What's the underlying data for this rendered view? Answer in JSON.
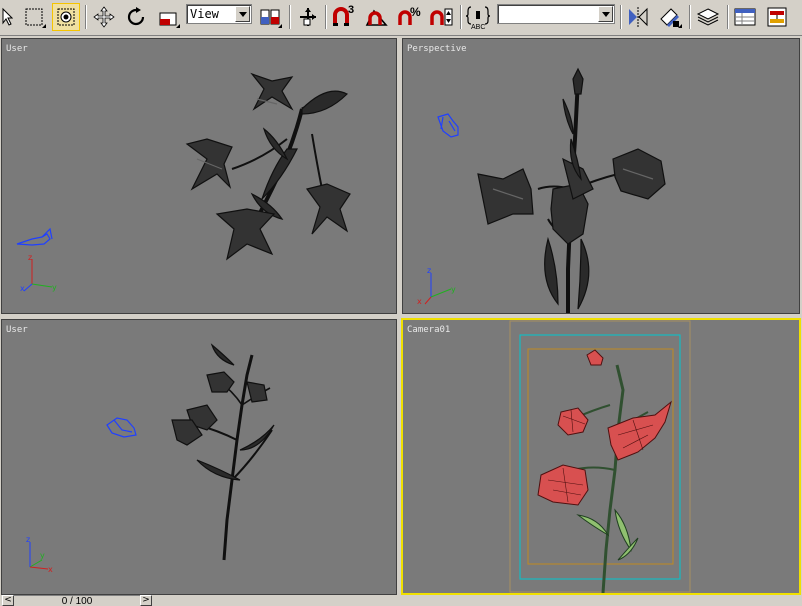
{
  "toolbar": {
    "view_dropdown": "View",
    "selection_set_dropdown": "",
    "spinner_snap_badge": "%",
    "angle_snap_badge": "3"
  },
  "viewports": [
    {
      "label": "User",
      "active": false
    },
    {
      "label": "Perspective",
      "active": false
    },
    {
      "label": "User",
      "active": false
    },
    {
      "label": "Camera01",
      "active": true
    }
  ],
  "axis_labels": {
    "x": "x",
    "y": "y",
    "z": "z"
  },
  "timeline": {
    "current_frame": "0",
    "separator": "/",
    "end_frame": "100"
  },
  "colors": {
    "active_viewport_border": "#f0e000",
    "viewport_bg": "#7a7a7a",
    "safe_frame_outer": "#00c8d0",
    "safe_frame_inner": "#c08a20",
    "flower_shaded": "#d85050"
  }
}
